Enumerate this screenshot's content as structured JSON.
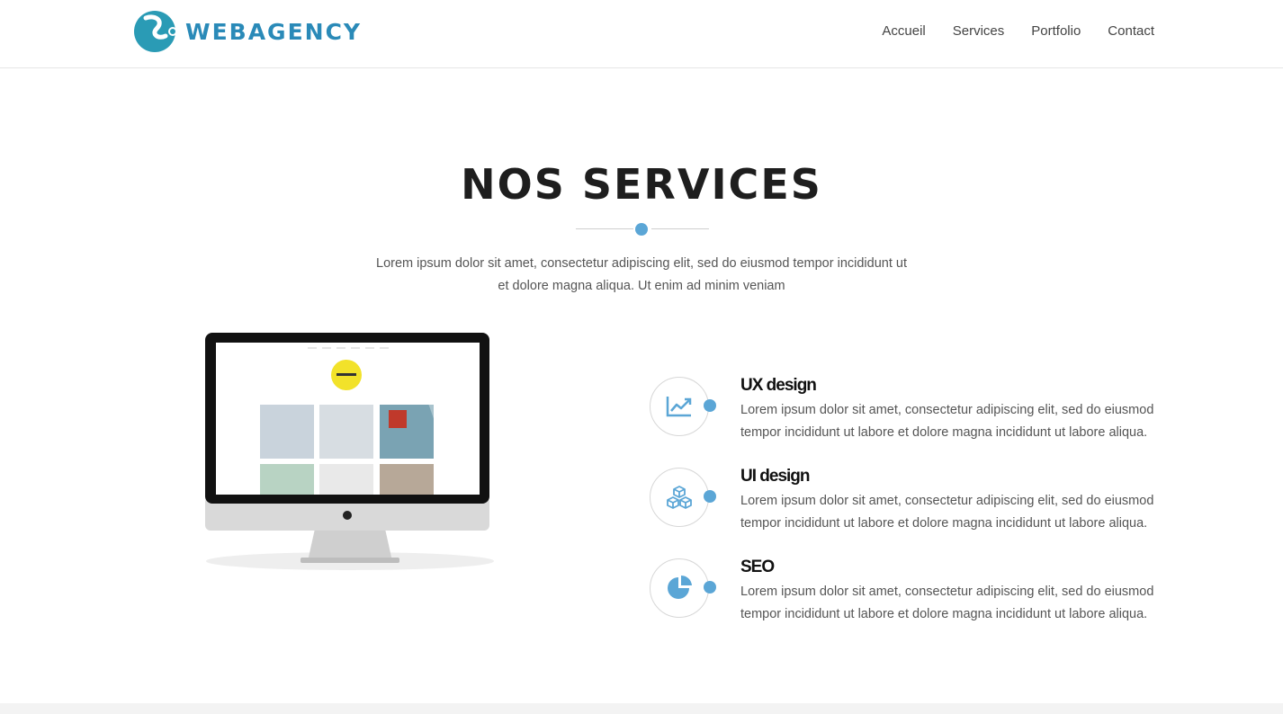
{
  "header": {
    "logo_text": "WEBAGENCY",
    "nav": [
      {
        "label": "Accueil"
      },
      {
        "label": "Services"
      },
      {
        "label": "Portfolio"
      },
      {
        "label": "Contact"
      }
    ]
  },
  "section": {
    "title": "NOS SERVICES",
    "intro": "Lorem ipsum dolor sit amet, consectetur adipiscing elit, sed do eiusmod tempor incididunt ut et dolore magna aliqua. Ut enim ad minim veniam"
  },
  "services": [
    {
      "name": "UX design",
      "icon": "chart-line-icon",
      "description": "Lorem ipsum dolor sit amet, consectetur adipiscing elit, sed do eiusmod tempor incididunt ut labore et dolore magna incididunt ut labore aliqua."
    },
    {
      "name": "UI design",
      "icon": "cubes-icon",
      "description": "Lorem ipsum dolor sit amet, consectetur adipiscing elit, sed do eiusmod tempor incididunt ut labore et dolore magna incididunt ut labore aliqua."
    },
    {
      "name": "SEO",
      "icon": "pie-chart-icon",
      "description": "Lorem ipsum dolor sit amet, consectetur adipiscing elit, sed do eiusmod tempor incididunt ut labore et dolore magna incididunt ut labore aliqua."
    }
  ],
  "colors": {
    "accent": "#5ba6d6",
    "brand": "#2a8ab8",
    "heading": "#1e1e1e"
  }
}
